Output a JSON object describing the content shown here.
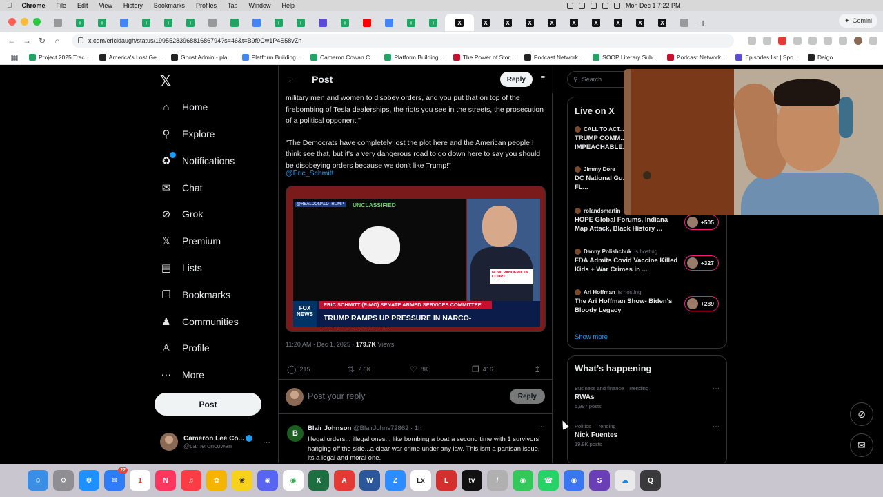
{
  "menubar": {
    "app": "Chrome",
    "items": [
      "File",
      "Edit",
      "View",
      "History",
      "Bookmarks",
      "Profiles",
      "Tab",
      "Window",
      "Help"
    ],
    "clock": "Mon Dec 1  7:22 PM"
  },
  "browser": {
    "url": "x.com/ericldaugh/status/1995528396881686794?s=46&t=B9f9Cw1P4S58vZn",
    "gemini_label": "Gemini",
    "bookmarks": [
      {
        "label": "Project 2025 Trac...",
        "color": "#1fa463"
      },
      {
        "label": "America's Lost Ge...",
        "color": "#222222"
      },
      {
        "label": "Ghost Admin - pla...",
        "color": "#222222"
      },
      {
        "label": "Platform Building...",
        "color": "#4285f4"
      },
      {
        "label": "Cameron Cowan C...",
        "color": "#1fa463"
      },
      {
        "label": "Platform Building...",
        "color": "#1fa463"
      },
      {
        "label": "The Power of Stor...",
        "color": "#c8102e"
      },
      {
        "label": "Podcast Network...",
        "color": "#222222"
      },
      {
        "label": "SOOP Literary Sub...",
        "color": "#1fa463"
      },
      {
        "label": "Podcast Network...",
        "color": "#c8102e"
      },
      {
        "label": "Episodes list | Spo...",
        "color": "#5b4bd6"
      },
      {
        "label": "Daigo",
        "color": "#222222"
      }
    ]
  },
  "nav": {
    "items": [
      {
        "label": "Home",
        "icon": "home-icon"
      },
      {
        "label": "Explore",
        "icon": "search-icon"
      },
      {
        "label": "Notifications",
        "icon": "bell-icon"
      },
      {
        "label": "Chat",
        "icon": "mail-icon"
      },
      {
        "label": "Grok",
        "icon": "grok-icon"
      },
      {
        "label": "Premium",
        "icon": "x-logo-icon"
      },
      {
        "label": "Lists",
        "icon": "list-icon"
      },
      {
        "label": "Bookmarks",
        "icon": "bookmark-icon"
      },
      {
        "label": "Communities",
        "icon": "people-icon"
      },
      {
        "label": "Profile",
        "icon": "person-icon"
      },
      {
        "label": "More",
        "icon": "more-icon"
      }
    ],
    "post_label": "Post",
    "account_name": "Cameron Lee Co...",
    "account_handle": "@cameroncowan"
  },
  "post": {
    "header_title": "Post",
    "reply_label": "Reply",
    "paragraph1": "military men and women to disobey orders, and you put that on top of the firebombing of Tesla dealerships, the riots you see in the streets, the prosecution of a political opponent.\"",
    "paragraph2": "\"The Democrats have completely lost the plot here and the American people I think see that, but it's a very dangerous road to go down here to say you should be disobeying orders because we don't like Trump!\"",
    "mention": "@Eric_Schmitt",
    "media": {
      "truth_label": "@REALDONALDTRUMP",
      "unclassified": "UNCLASSIFIED",
      "fox_label": "FOX NEWS",
      "lower_third_top": "ERIC SCHMITT (R-MO)  SENATE ARMED SERVICES COMMITTEE",
      "lower_third_main": "TRUMP RAMPS UP PRESSURE IN NARCO-TERRORIST FIGHT",
      "now_label": "NOW: PANDEMIC IN COURT"
    },
    "time": "11:20 AM · Dec 1, 2025 · ",
    "views_count": "179.7K",
    "views_label": " Views",
    "stats": {
      "replies": "215",
      "reposts": "2.6K",
      "likes": "8K",
      "bookmarks": "416"
    },
    "reply_placeholder": "Post your reply",
    "reply_button": "Reply"
  },
  "comment": {
    "initial": "B",
    "name": "Blair Johnson",
    "handle": "@BlairJohns72862 · 1h",
    "text": "Illegal orders... illegal ones... like bombing a boat a second time with 1 survivors hanging off the side...a clear war crime under any law. This isnt a partisan issue, its a legal and moral one."
  },
  "sidebar": {
    "search_placeholder": "Search",
    "live_title": "Live on X",
    "live": [
      {
        "host": "CALL TO ACT...",
        "hosting": "",
        "topic": "TRUMP COMM... IMPEACHABLE...",
        "count": ""
      },
      {
        "host": "Jimmy Dore",
        "hosting": "",
        "topic": "DC National Gu... Was a FALSE FL...",
        "count": ""
      },
      {
        "host": "rolandsmartin",
        "hosting": "",
        "topic": "HOPE Global Forums, Indiana Map Attack, Black History ...",
        "count": "+505"
      },
      {
        "host": "Danny Polishchuk",
        "hosting": "is hosting",
        "topic": "FDA Admits Covid Vaccine Killed Kids + War Crimes in ...",
        "count": "+327"
      },
      {
        "host": "Ari Hoffman",
        "hosting": "is hosting",
        "topic": "The Ari Hoffman Show- Biden's Bloody Legacy",
        "count": "+289"
      }
    ],
    "show_more": "Show more",
    "happening_title": "What’s happening",
    "trends": [
      {
        "category": "Business and finance · Trending",
        "name": "RWAs",
        "count": "5,997 posts"
      },
      {
        "category": "Politics · Trending",
        "name": "Nick Fuentes",
        "count": "19.9K posts"
      }
    ]
  },
  "dock": {
    "apps": [
      "finder-icon",
      "settings-icon",
      "safari-icon",
      "mail-icon",
      "calendar-icon",
      "news-icon",
      "music-icon",
      "photos-icon",
      "tes-icon",
      "discord-icon",
      "chrome-icon",
      "excel-icon",
      "acrobat-icon",
      "word-icon",
      "zoom-icon",
      "lx-icon",
      "live-icon",
      "tv-icon",
      "scripts-icon",
      "messages-icon",
      "whatsapp-icon",
      "signal-icon",
      "scrivener-icon",
      "cloud-icon",
      "quicktime-icon"
    ],
    "calendar_day": "1",
    "mail_badge": "22"
  }
}
